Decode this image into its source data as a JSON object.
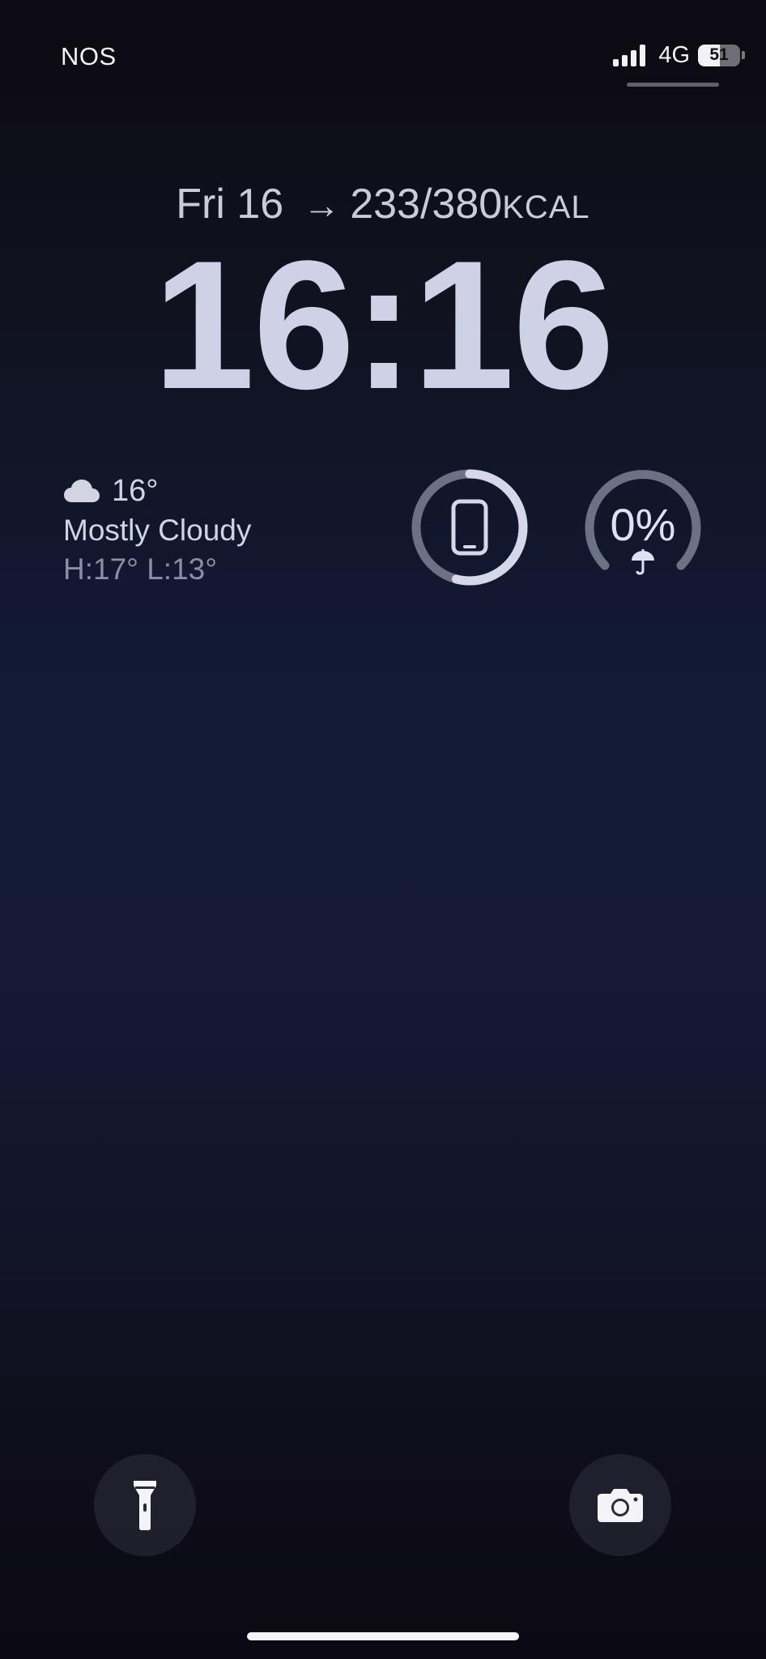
{
  "status_bar": {
    "carrier": "NOS",
    "network": "4G",
    "battery_level": "51",
    "battery_fraction": 0.51,
    "signal_bars": 4
  },
  "lock_screen": {
    "date": "Fri 16",
    "activity": {
      "arrow_icon": "arrow-right-icon",
      "value": "233/380",
      "unit": "KCAL"
    },
    "time": "16:16"
  },
  "widgets": {
    "weather": {
      "icon": "cloud-icon",
      "temperature": "16°",
      "condition": "Mostly Cloudy",
      "high_low": "H:17° L:13°"
    },
    "device_battery": {
      "icon": "iphone-icon",
      "level_fraction": 0.54
    },
    "rain": {
      "percentage": "0%",
      "icon": "umbrella-icon"
    }
  },
  "controls": {
    "left": "flashlight-icon",
    "right": "camera-icon"
  },
  "colors": {
    "text_primary": "#cfd2e6",
    "text_secondary": "#8b8ea6",
    "gauge_track": "#6e7186",
    "gauge_fill": "#d6d8ea",
    "background_mid": "#121a36"
  }
}
